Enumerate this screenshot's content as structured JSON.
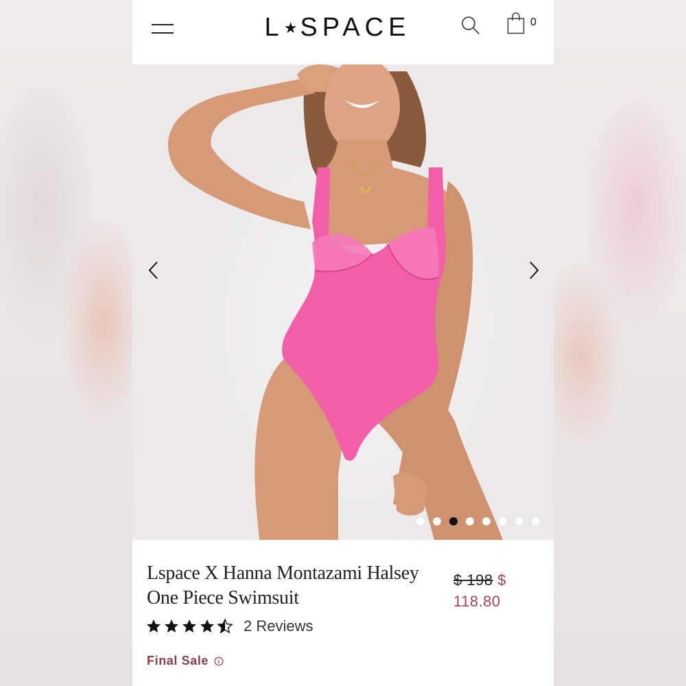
{
  "header": {
    "logo": "L★SPACE",
    "logo_left": "L",
    "logo_star": "★",
    "logo_right": "SPACE",
    "cart_count": "0",
    "icons": [
      "menu-icon",
      "search-icon",
      "shopping-bag-icon"
    ]
  },
  "gallery": {
    "image_count": 8,
    "active_index": 2,
    "icons": [
      "chevron-left-icon",
      "chevron-right-icon"
    ]
  },
  "product": {
    "title": "Lspace X Hanna Montazami Halsey One Piece Swimsuit",
    "price_original": "$ 198",
    "price_sale": "$ 118.80",
    "rating_value": 4.5,
    "rating_max": 5,
    "reviews_label": "2 Reviews",
    "final_sale_label": "Final Sale"
  },
  "colors": {
    "price_sale": "#a14450",
    "final_sale": "#8a3f4b",
    "swimsuit": "#f25ea8"
  }
}
